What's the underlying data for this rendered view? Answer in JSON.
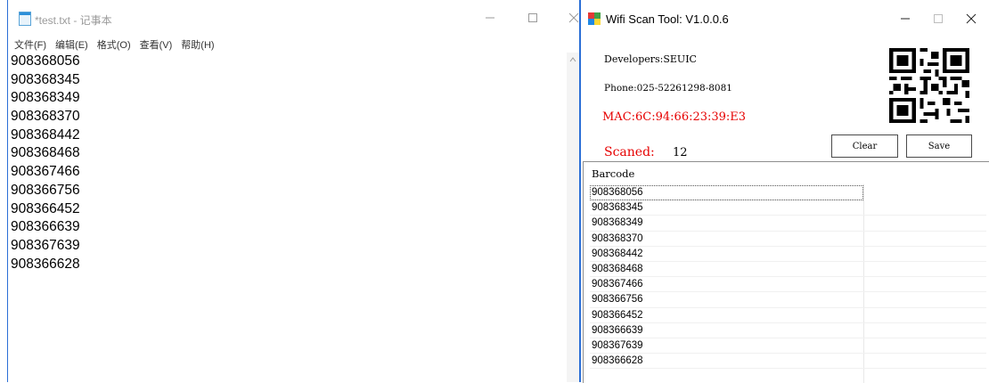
{
  "notepad": {
    "title": "*test.txt - 记事本",
    "menu": [
      "文件(F)",
      "编辑(E)",
      "格式(O)",
      "查看(V)",
      "帮助(H)"
    ],
    "lines": [
      "908368056",
      "908368345",
      "908368349",
      "908368370",
      "908368442",
      "908368468",
      "908367466",
      "908366756",
      "908366452",
      "908366639",
      "908367639",
      "908366628"
    ],
    "controls": {
      "minimize": "—",
      "maximize": "☐",
      "close": "✕"
    }
  },
  "wifi_tool": {
    "title": "Wifi Scan Tool: V1.0.0.6",
    "developers": "Developers:SEUIC",
    "phone": "Phone:025-52261298-8081",
    "mac": "MAC:6C:94:66:23:39:E3",
    "scaned_label": "Scaned:",
    "scaned_value": "12",
    "clear_label": "Clear",
    "save_label": "Save",
    "column_header": "Barcode",
    "rows": [
      "908368056",
      "908368345",
      "908368349",
      "908368370",
      "908368442",
      "908368468",
      "908367466",
      "908366756",
      "908366452",
      "908366639",
      "908367639",
      "908366628"
    ],
    "controls": {
      "minimize": "—",
      "maximize": "☐",
      "close": "✕"
    },
    "colors": {
      "mac": "#e60000",
      "scaned_label": "#e60000"
    }
  }
}
